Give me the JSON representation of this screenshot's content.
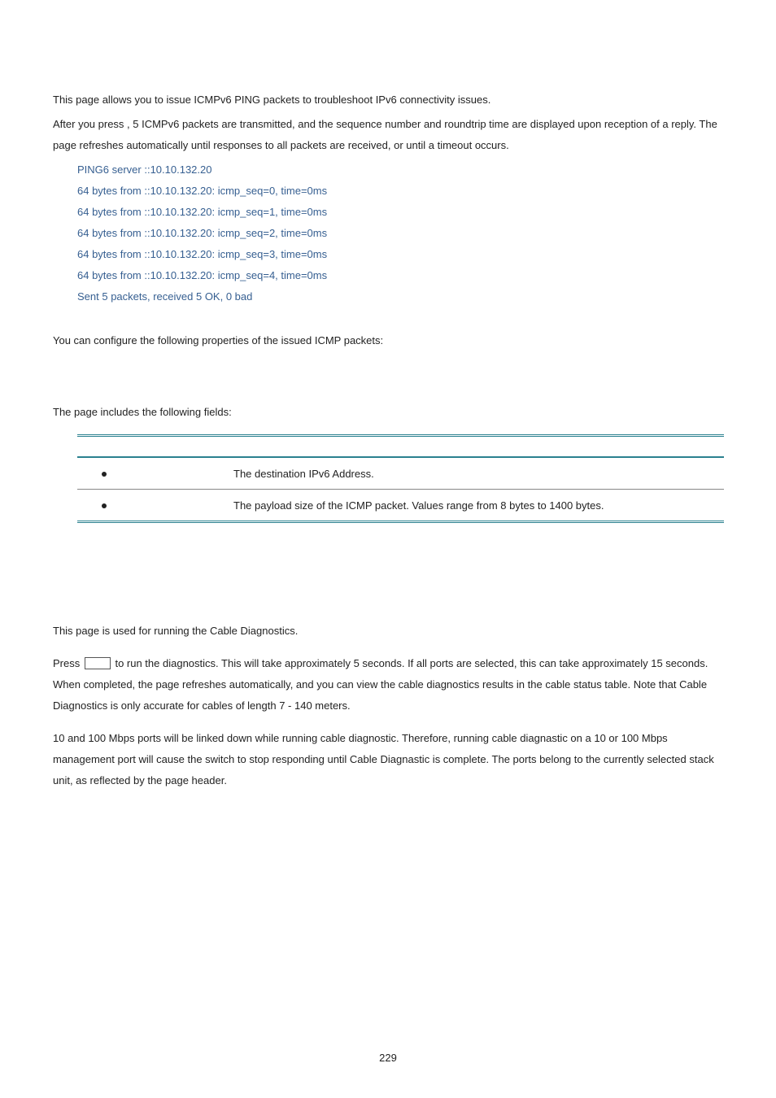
{
  "intro1": "This page allows you to issue ICMPv6 PING packets to troubleshoot IPv6 connectivity issues.",
  "intro2": "After you press , 5 ICMPv6 packets are transmitted, and the sequence number and roundtrip time are displayed upon reception of a reply. The page refreshes automatically until responses to all packets are received, or until a timeout occurs.",
  "sample": {
    "l0": "PING6 server ::10.10.132.20",
    "l1": "64 bytes from ::10.10.132.20: icmp_seq=0, time=0ms",
    "l2": "64 bytes from ::10.10.132.20: icmp_seq=1, time=0ms",
    "l3": "64 bytes from ::10.10.132.20: icmp_seq=2, time=0ms",
    "l4": "64 bytes from ::10.10.132.20: icmp_seq=3, time=0ms",
    "l5": "64 bytes from ::10.10.132.20: icmp_seq=4, time=0ms",
    "l6": "Sent 5 packets, received 5 OK, 0 bad"
  },
  "config_note": "You can configure the following properties of the issued ICMP packets:",
  "fields_intro": "The page includes the following fields:",
  "table": {
    "row1": "The destination IPv6 Address.",
    "row2": "The payload size of the ICMP packet. Values range from 8 bytes to 1400 bytes."
  },
  "cable": {
    "p1": "This page is used for running the Cable Diagnostics.",
    "p2a": "Press ",
    "p2b": " to run the diagnostics. This will take approximately 5 seconds. If all ports are selected, this can take approximately 15 seconds. When completed, the page refreshes automatically, and you can view the cable diagnostics results in the cable status table. Note that Cable Diagnostics is only accurate for cables of length 7 - 140 meters.",
    "p3": "10 and 100 Mbps ports will be linked down while running cable diagnostic. Therefore, running cable diagnastic on a 10 or 100 Mbps management port will cause the switch to stop responding until Cable Diagnastic is complete. The ports belong to the currently selected stack unit, as reflected by the page header."
  },
  "page_number": "229"
}
